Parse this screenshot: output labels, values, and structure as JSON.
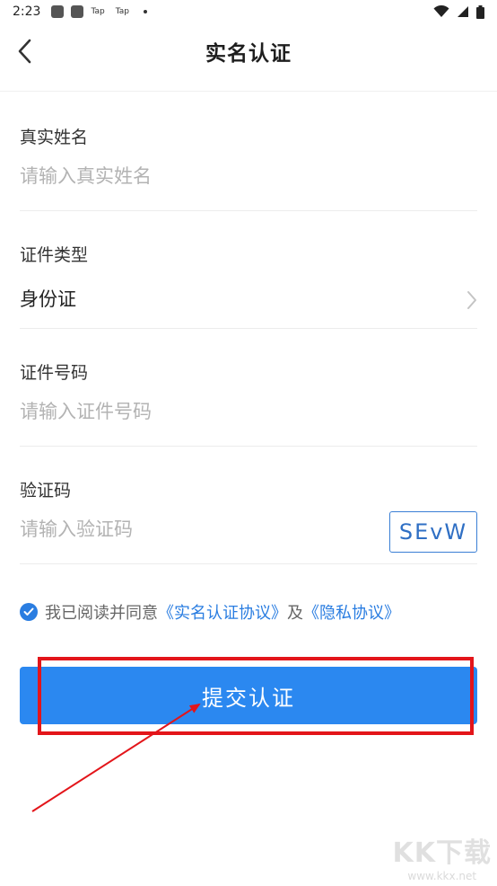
{
  "status_bar": {
    "time": "2:23",
    "app_labels": [
      "Tap",
      "Tap"
    ]
  },
  "header": {
    "title": "实名认证",
    "back_icon": "chevron-left-icon"
  },
  "form": {
    "name": {
      "label": "真实姓名",
      "placeholder": "请输入真实姓名"
    },
    "id_type": {
      "label": "证件类型",
      "value": "身份证",
      "icon": "chevron-right-icon"
    },
    "id_number": {
      "label": "证件号码",
      "placeholder": "请输入证件号码"
    },
    "captcha": {
      "label": "验证码",
      "placeholder": "请输入验证码",
      "code": "SEvW"
    }
  },
  "agreement": {
    "checked": true,
    "prefix": "我已阅读并同意",
    "link1": "《实名认证协议》",
    "conjunction": "及",
    "link2": "《隐私协议》"
  },
  "submit": {
    "label": "提交认证"
  },
  "watermark": {
    "logo": "KK下载",
    "url": "www.kkx.net"
  },
  "colors": {
    "accent": "#2b88f0",
    "link": "#2a7de1",
    "annotation": "#e3151a"
  }
}
